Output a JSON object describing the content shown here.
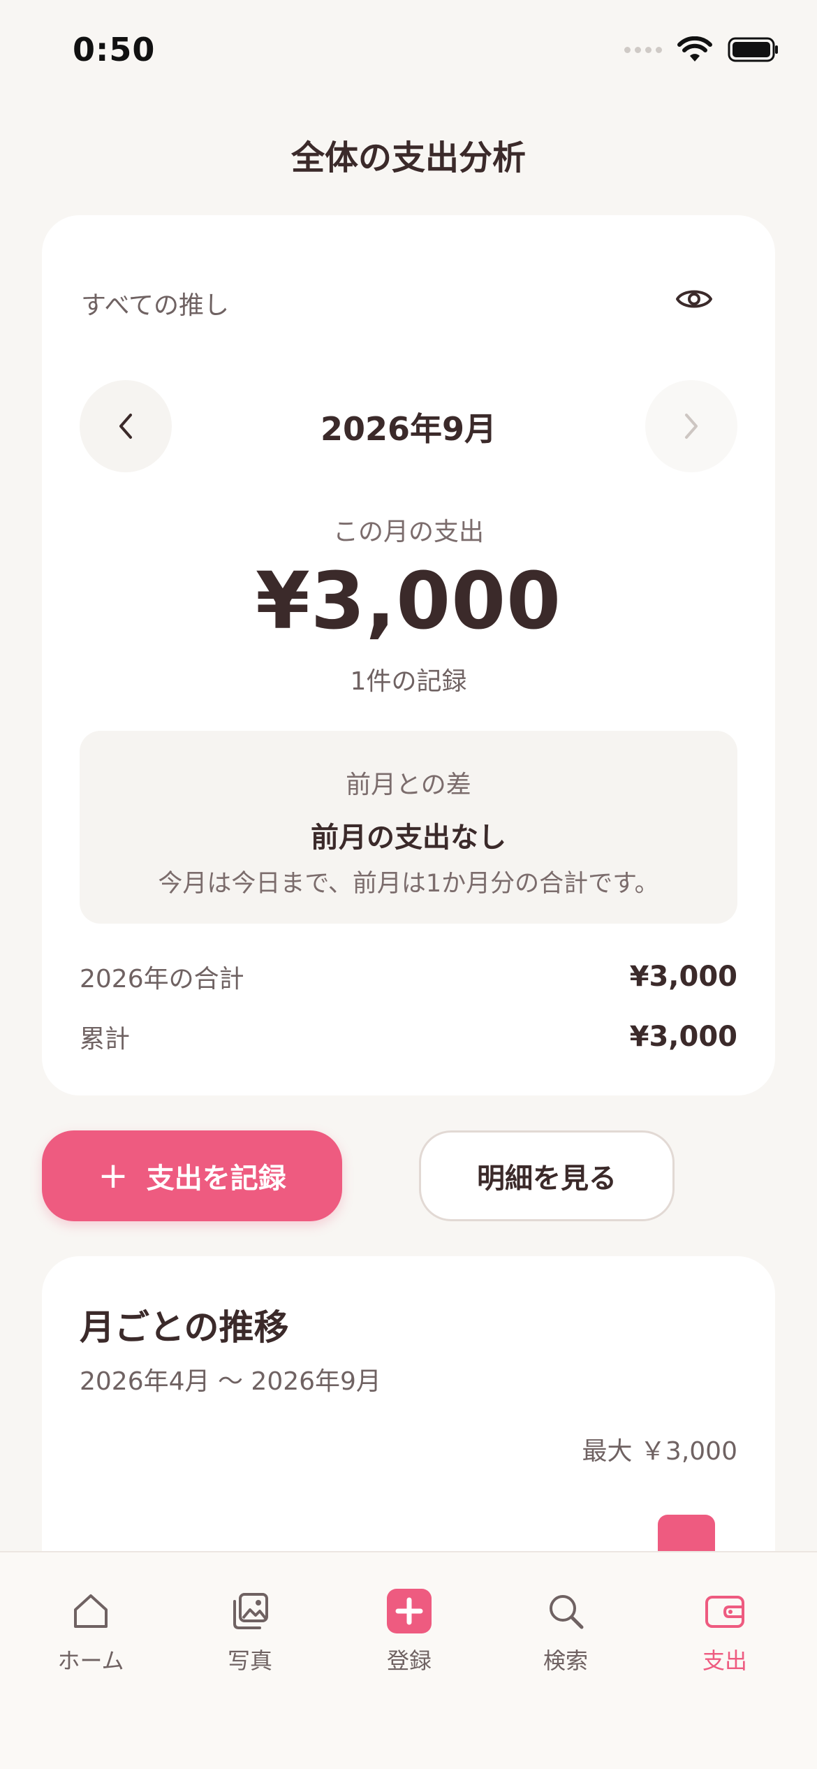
{
  "status_bar": {
    "time": "0:50"
  },
  "header": {
    "title": "全体の支出分析"
  },
  "summary": {
    "oshi_label": "すべての推し",
    "month_label": "2026年9月",
    "spend_caption": "この月の支出",
    "spend_amount": "¥3,000",
    "record_count": "1件の記録",
    "diff": {
      "title": "前月との差",
      "main": "前月の支出なし",
      "note": "今月は今日まで、前月は1か月分の合計です。"
    },
    "year_total_label": "2026年の合計",
    "year_total_value": "¥3,000",
    "cumulative_label": "累計",
    "cumulative_value": "¥3,000"
  },
  "actions": {
    "record_label": "支出を記録",
    "detail_label": "明細を見る"
  },
  "trend": {
    "title": "月ごとの推移",
    "range": "2026年4月 〜 2026年9月",
    "max_label": "最大 ￥3,000"
  },
  "tabbar": {
    "home": "ホーム",
    "photo": "写真",
    "add": "登録",
    "search": "検索",
    "expense": "支出"
  },
  "colors": {
    "accent": "#ee5b80",
    "text": "#3b2a2a",
    "background": "#f8f6f3"
  }
}
